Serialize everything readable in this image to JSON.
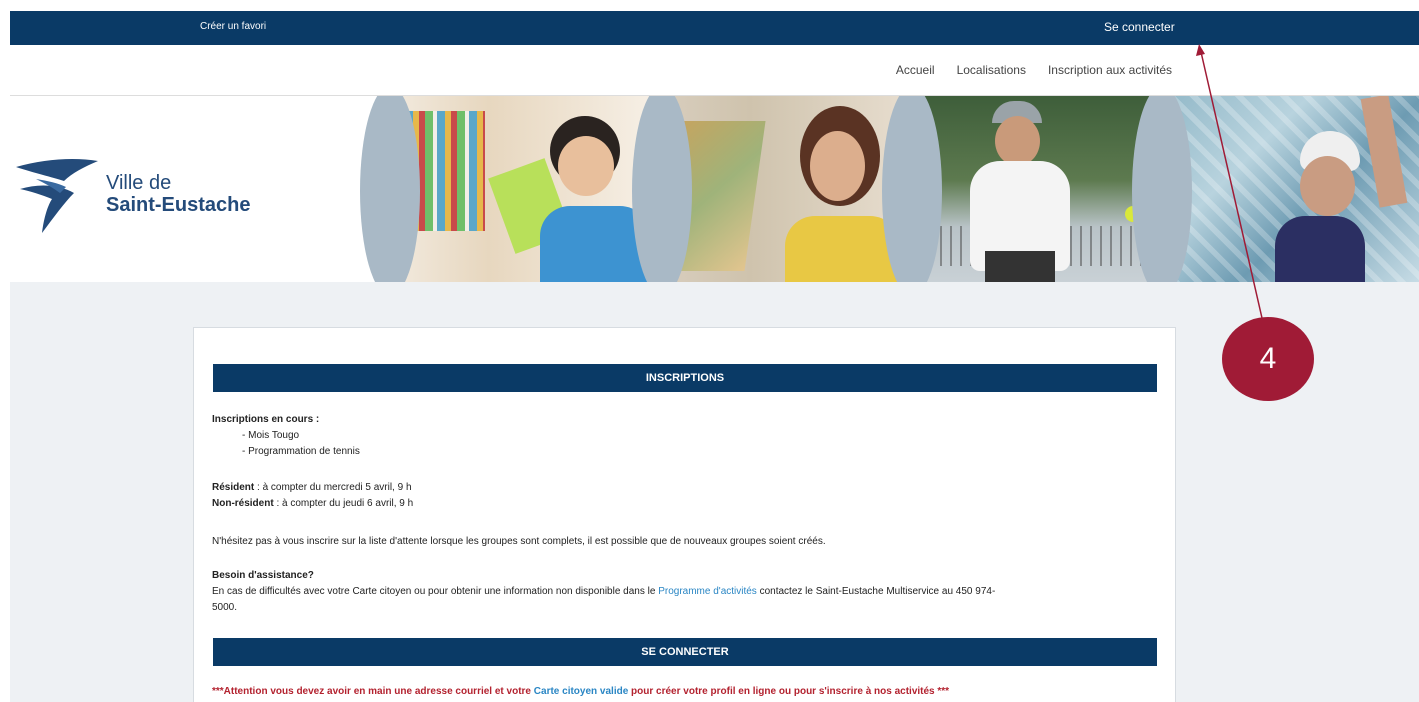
{
  "topbar": {
    "favorite_label": "Créer un favori",
    "login_label": "Se connecter"
  },
  "nav": {
    "items": [
      "Accueil",
      "Localisations",
      "Inscription aux activités"
    ]
  },
  "logo": {
    "line1": "Ville de",
    "line2": "Saint-Eustache"
  },
  "main": {
    "inscriptions_title": "INSCRIPTIONS",
    "current_label": "Inscriptions en cours :",
    "current_items": [
      "- Mois Tougo",
      "- Programmation de tennis"
    ],
    "resident_label": "Résident",
    "resident_text": " : à compter du mercredi 5 avril, 9 h",
    "nonresident_label": "Non-résident",
    "nonresident_text": " : à compter du jeudi 6 avril, 9 h",
    "waitlist_text": "N'hésitez pas à vous inscrire sur la liste d'attente lorsque les groupes sont complets, il est possible que de nouveaux groupes soient créés.",
    "assist_title": "Besoin d'assistance?",
    "assist_text_1": "En cas de difficultés avec votre Carte citoyen ou pour obtenir une information non disponible dans le ",
    "assist_link": "Programme d'activités",
    "assist_text_2": " contactez le Saint-Eustache Multiservice au 450 974-",
    "assist_text_3": "5000.",
    "login_title": "SE CONNECTER",
    "warning_1": "***Attention vous devez avoir en main une adresse courriel et votre ",
    "warning_link": "Carte citoyen valide",
    "warning_2": " pour créer votre profil en ligne ou pour s'inscrire à nos activités ***"
  },
  "callout": {
    "number": "4"
  },
  "colors": {
    "navy": "#0a3a66",
    "accent_red": "#a01b36",
    "link_blue": "#2a86c4"
  }
}
